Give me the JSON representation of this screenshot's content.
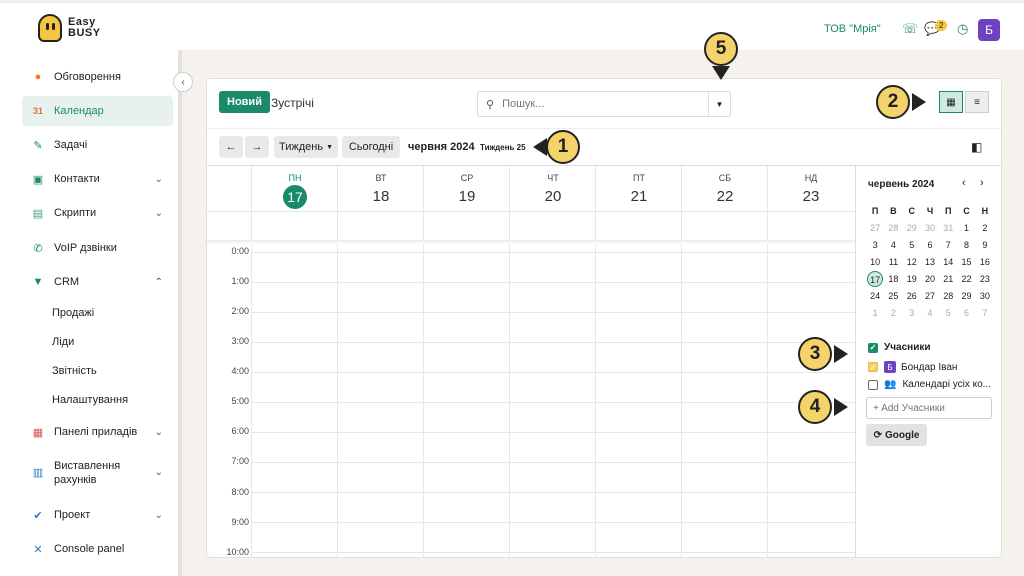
{
  "app": {
    "logo_line1": "Easy",
    "logo_line2": "BUSY",
    "company": "ТОВ \"Мрія\"",
    "chat_count": "2",
    "user_initial": "Б"
  },
  "sidebar": {
    "items": [
      {
        "label": "Обговорення",
        "icon": "chat-bubble-icon",
        "top": 0
      },
      {
        "label": "Календар",
        "icon": "calendar-icon"
      },
      {
        "label": "Задачі",
        "icon": "pen-icon"
      },
      {
        "label": "Контакти",
        "icon": "contacts-icon"
      },
      {
        "label": "Скрипти",
        "icon": "scripts-icon"
      },
      {
        "label": "VoIP дзвінки",
        "icon": "phone-icon"
      },
      {
        "label": "CRM",
        "icon": "crm-icon"
      },
      {
        "label": "Панелі приладів",
        "icon": "dashboard-icon"
      },
      {
        "label": "Виставлення рахунків",
        "icon": "invoice-icon"
      },
      {
        "label": "Проект",
        "icon": "check-icon"
      },
      {
        "label": "Console panel",
        "icon": "tools-icon"
      }
    ],
    "crm_sub": [
      "Продажі",
      "Ліди",
      "Звітність",
      "Налаштування"
    ]
  },
  "header": {
    "new_button": "Новий",
    "title": "Зустрічі",
    "search_placeholder": "Пошук..."
  },
  "toolbar": {
    "prev": "←",
    "next": "→",
    "view_mode": "Тиждень",
    "today": "Сьогодні",
    "period": "червня 2024",
    "week_number": "Тиждень 25"
  },
  "days": [
    {
      "name": "ПН",
      "num": "17"
    },
    {
      "name": "ВТ",
      "num": "18"
    },
    {
      "name": "СР",
      "num": "19"
    },
    {
      "name": "ЧТ",
      "num": "20"
    },
    {
      "name": "ПТ",
      "num": "21"
    },
    {
      "name": "СБ",
      "num": "22"
    },
    {
      "name": "НД",
      "num": "23"
    }
  ],
  "hours": [
    "0:00",
    "1:00",
    "2:00",
    "3:00",
    "4:00",
    "5:00",
    "6:00",
    "7:00",
    "8:00",
    "9:00",
    "10:00"
  ],
  "mini_calendar": {
    "title": "червень 2024",
    "prev": "‹",
    "next": "›",
    "headers": [
      "П",
      "В",
      "С",
      "Ч",
      "П",
      "С",
      "Н"
    ],
    "weeks": [
      [
        "27",
        "28",
        "29",
        "30",
        "31",
        "1",
        "2"
      ],
      [
        "3",
        "4",
        "5",
        "6",
        "7",
        "8",
        "9"
      ],
      [
        "10",
        "11",
        "12",
        "13",
        "14",
        "15",
        "16"
      ],
      [
        "17",
        "18",
        "19",
        "20",
        "21",
        "22",
        "23"
      ],
      [
        "24",
        "25",
        "26",
        "27",
        "28",
        "29",
        "30"
      ],
      [
        "1",
        "2",
        "3",
        "4",
        "5",
        "6",
        "7"
      ]
    ]
  },
  "attendees": {
    "heading": "Учасники",
    "user": "Бондар Іван",
    "user_initial": "Б",
    "all_calendars": "Календарі усіх ко...",
    "add_placeholder": "+ Add Учасники",
    "google_button": "Google"
  },
  "callouts": [
    "1",
    "2",
    "3",
    "4",
    "5"
  ],
  "colors": {
    "accent": "#1a8a6b",
    "avatar": "#6f42c1",
    "callout": "#f4d36b"
  }
}
